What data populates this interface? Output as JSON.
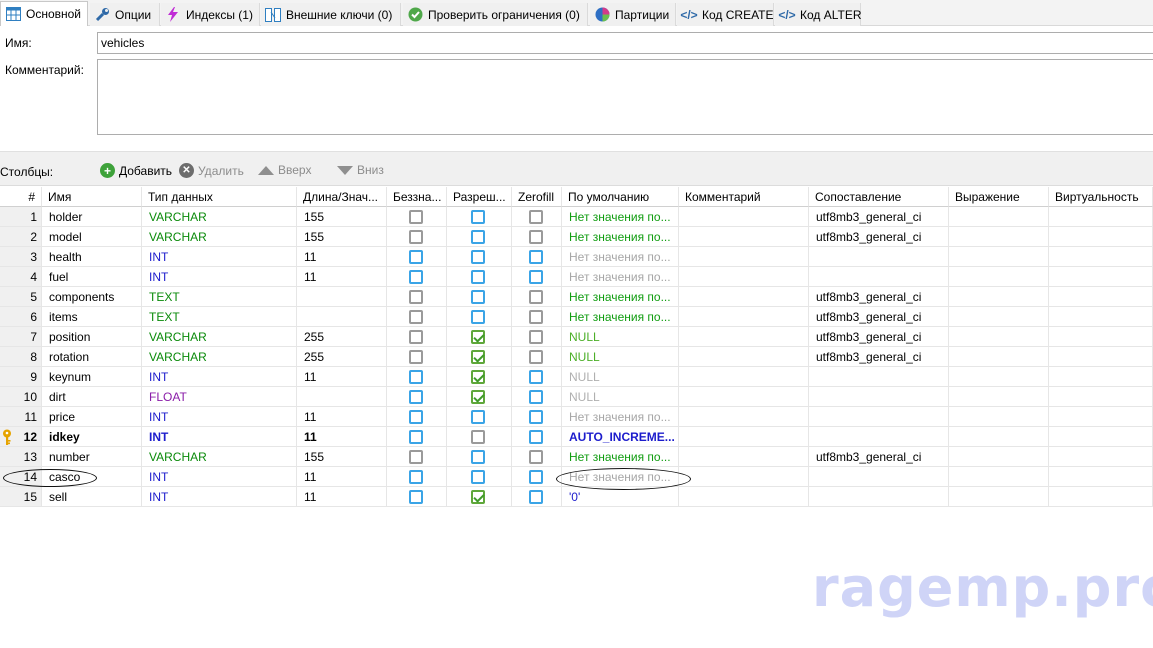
{
  "tabs": [
    {
      "label": "Основной",
      "icon": "table-icon"
    },
    {
      "label": "Опции",
      "icon": "wrench-icon"
    },
    {
      "label": "Индексы (1)",
      "icon": "lightning-icon"
    },
    {
      "label": "Внешние ключи (0)",
      "icon": "foreign-key-icon"
    },
    {
      "label": "Проверить ограничения (0)",
      "icon": "check-icon"
    },
    {
      "label": "Партиции",
      "icon": "globe-icon"
    },
    {
      "label": "Код CREATE",
      "icon": "code-icon"
    },
    {
      "label": "Код ALTER",
      "icon": "code-icon"
    }
  ],
  "form": {
    "name_label": "Имя:",
    "name_value": "vehicles",
    "comment_label": "Комментарий:",
    "comment_value": ""
  },
  "columns_toolbar": {
    "label": "Столбцы:",
    "add": "Добавить",
    "remove": "Удалить",
    "up": "Вверх",
    "down": "Вниз"
  },
  "headers": [
    "#",
    "Имя",
    "Тип данных",
    "Длина/Знач...",
    "Беззна...",
    "Разреш...",
    "Zerofill",
    "По умолчанию",
    "Комментарий",
    "Сопоставление",
    "Выражение",
    "Виртуальность"
  ],
  "rows": [
    {
      "num": "1",
      "name": "holder",
      "type": "VARCHAR",
      "length": "155",
      "unsigned": "off",
      "allow_null": "off",
      "zerofill": "off",
      "default": "Нет значения по...",
      "comment": "",
      "collation": "utf8mb3_general_ci"
    },
    {
      "num": "2",
      "name": "model",
      "type": "VARCHAR",
      "length": "155",
      "unsigned": "off",
      "allow_null": "off",
      "zerofill": "off",
      "default": "Нет значения по...",
      "comment": "",
      "collation": "utf8mb3_general_ci"
    },
    {
      "num": "3",
      "name": "health",
      "type": "INT",
      "length": "11",
      "unsigned": "off",
      "allow_null": "off",
      "zerofill": "off",
      "default": "Нет значения по...",
      "comment": "",
      "collation": ""
    },
    {
      "num": "4",
      "name": "fuel",
      "type": "INT",
      "length": "11",
      "unsigned": "off",
      "allow_null": "off",
      "zerofill": "off",
      "default": "Нет значения по...",
      "comment": "",
      "collation": ""
    },
    {
      "num": "5",
      "name": "components",
      "type": "TEXT",
      "length": "",
      "unsigned": "off",
      "allow_null": "off",
      "zerofill": "off",
      "default": "Нет значения по...",
      "comment": "",
      "collation": "utf8mb3_general_ci"
    },
    {
      "num": "6",
      "name": "items",
      "type": "TEXT",
      "length": "",
      "unsigned": "off",
      "allow_null": "off",
      "zerofill": "off",
      "default": "Нет значения по...",
      "comment": "",
      "collation": "utf8mb3_general_ci"
    },
    {
      "num": "7",
      "name": "position",
      "type": "VARCHAR",
      "length": "255",
      "unsigned": "off",
      "allow_null": "on",
      "zerofill": "off",
      "default": "NULL",
      "comment": "",
      "collation": "utf8mb3_general_ci"
    },
    {
      "num": "8",
      "name": "rotation",
      "type": "VARCHAR",
      "length": "255",
      "unsigned": "off",
      "allow_null": "on",
      "zerofill": "off",
      "default": "NULL",
      "comment": "",
      "collation": "utf8mb3_general_ci"
    },
    {
      "num": "9",
      "name": "keynum",
      "type": "INT",
      "length": "11",
      "unsigned": "off",
      "allow_null": "on",
      "zerofill": "off",
      "default": "NULL",
      "comment": "",
      "collation": ""
    },
    {
      "num": "10",
      "name": "dirt",
      "type": "FLOAT",
      "length": "",
      "unsigned": "off",
      "allow_null": "on",
      "zerofill": "off",
      "default": "NULL",
      "comment": "",
      "collation": ""
    },
    {
      "num": "11",
      "name": "price",
      "type": "INT",
      "length": "11",
      "unsigned": "off",
      "allow_null": "off",
      "zerofill": "off",
      "default": "Нет значения по...",
      "comment": "",
      "collation": ""
    },
    {
      "num": "12",
      "name": "idkey",
      "type": "INT",
      "length": "11",
      "unsigned": "off",
      "allow_null": "off",
      "zerofill": "off",
      "default": "AUTO_INCREME...",
      "comment": "",
      "collation": "",
      "primary_key": true
    },
    {
      "num": "13",
      "name": "number",
      "type": "VARCHAR",
      "length": "155",
      "unsigned": "off",
      "allow_null": "off",
      "zerofill": "off",
      "default": "Нет значения по...",
      "comment": "",
      "collation": "utf8mb3_general_ci"
    },
    {
      "num": "14",
      "name": "casco",
      "type": "INT",
      "length": "11",
      "unsigned": "off",
      "allow_null": "off",
      "zerofill": "off",
      "default": "Нет значения по...",
      "comment": "",
      "collation": ""
    },
    {
      "num": "15",
      "name": "sell",
      "type": "INT",
      "length": "11",
      "unsigned": "off",
      "allow_null": "on",
      "zerofill": "off",
      "default": "'0'",
      "comment": "",
      "collation": ""
    }
  ],
  "watermark": "ragemp.pro",
  "colors": {
    "string_type": "#0a8a0a",
    "numeric_type": "#1c1ccc",
    "float_type": "#8a1ca8",
    "checkbox_blue": "#3aa4e6",
    "checkbox_green": "#5ea73a"
  }
}
